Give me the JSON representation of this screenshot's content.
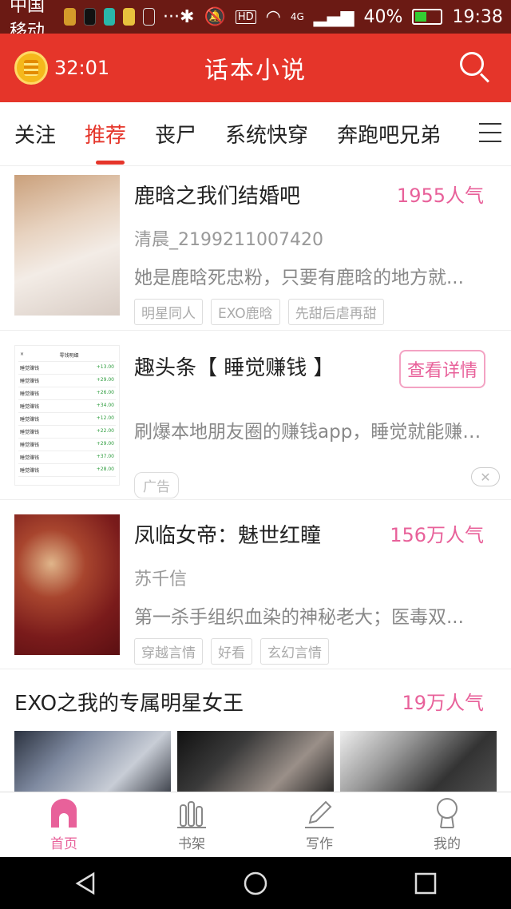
{
  "status_bar": {
    "carrier": "中国移动",
    "network": "4G",
    "battery": "40%",
    "time": "19:38"
  },
  "app_bar": {
    "timer": "32:01",
    "title": "话本小说"
  },
  "tabs": [
    {
      "label": "关注",
      "active": false
    },
    {
      "label": "推荐",
      "active": true
    },
    {
      "label": "丧尸",
      "active": false
    },
    {
      "label": "系统快穿",
      "active": false
    },
    {
      "label": "奔跑吧兄弟",
      "active": false
    }
  ],
  "books": [
    {
      "title": "鹿晗之我们结婚吧",
      "popularity": "1955人气",
      "author": "清晨_2199211007420",
      "desc": "她是鹿晗死忠粉，只要有鹿晗的地方就...",
      "tags": [
        "明星同人",
        "EXO鹿晗",
        "先甜后虐再甜"
      ]
    },
    {
      "title": "凤临女帝：魅世红瞳",
      "popularity": "156万人气",
      "author": "苏千信",
      "desc": "第一杀手组织血染的神秘老大；医毒双...",
      "tags": [
        "穿越言情",
        "好看",
        "玄幻言情"
      ]
    }
  ],
  "ad": {
    "title": "趣头条【 睡觉赚钱 】",
    "button": "查看详情",
    "desc": "刷爆本地朋友圈的赚钱app，睡觉就能赚钱!",
    "tag": "广告",
    "thumb_rows": [
      {
        "label": "睡觉赚钱",
        "amount": "+13.00"
      },
      {
        "label": "睡觉赚钱",
        "amount": "+29.00"
      },
      {
        "label": "睡觉赚钱",
        "amount": "+26.00"
      },
      {
        "label": "睡觉赚钱",
        "amount": "+34.00"
      },
      {
        "label": "睡觉赚钱",
        "amount": "+12.00"
      },
      {
        "label": "睡觉赚钱",
        "amount": "+22.00"
      },
      {
        "label": "睡觉赚钱",
        "amount": "+29.00"
      },
      {
        "label": "睡觉赚钱",
        "amount": "+37.00"
      },
      {
        "label": "睡觉赚钱",
        "amount": "+28.00"
      }
    ]
  },
  "featured": {
    "title": "EXO之我的专属明星女王",
    "popularity": "19万人气"
  },
  "bottom_nav": [
    {
      "label": "首页",
      "icon": "home-icon",
      "active": true
    },
    {
      "label": "书架",
      "icon": "bookshelf-icon",
      "active": false
    },
    {
      "label": "写作",
      "icon": "pencil-icon",
      "active": false
    },
    {
      "label": "我的",
      "icon": "profile-icon",
      "active": false
    }
  ],
  "colors": {
    "accent_red": "#e5352a",
    "accent_pink": "#e8619a",
    "status_bar": "#6b1a14"
  }
}
